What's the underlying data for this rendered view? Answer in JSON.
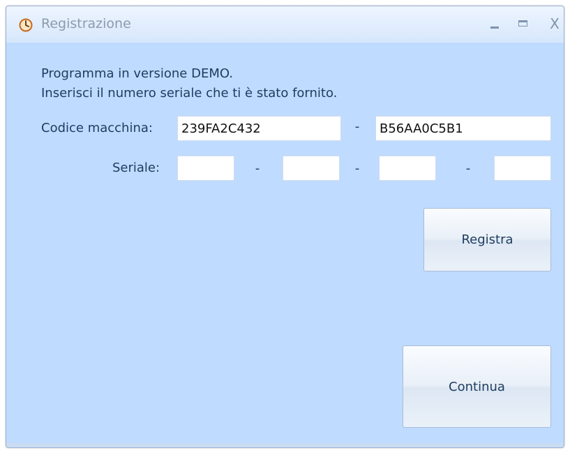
{
  "window": {
    "title": "Registrazione",
    "icon": "clock-icon",
    "controls": {
      "minimize": "minimize-icon",
      "maximize": "maximize-icon",
      "close_label": "X"
    }
  },
  "message": {
    "line1": "Programma in versione DEMO.",
    "line2": "Inserisci il numero seriale che ti è stato fornito."
  },
  "machine_code": {
    "label": "Codice macchina:",
    "part1": "239FA2C432",
    "separator": "-",
    "part2": "B56AA0C5B1"
  },
  "serial": {
    "label": "Seriale:",
    "parts": [
      "",
      "",
      "",
      ""
    ],
    "separator": "-"
  },
  "buttons": {
    "register": "Registra",
    "continue": "Continua"
  },
  "colors": {
    "window_bg": "#bfdbff",
    "text": "#1e3c5e",
    "title_text": "#8c9bab"
  }
}
